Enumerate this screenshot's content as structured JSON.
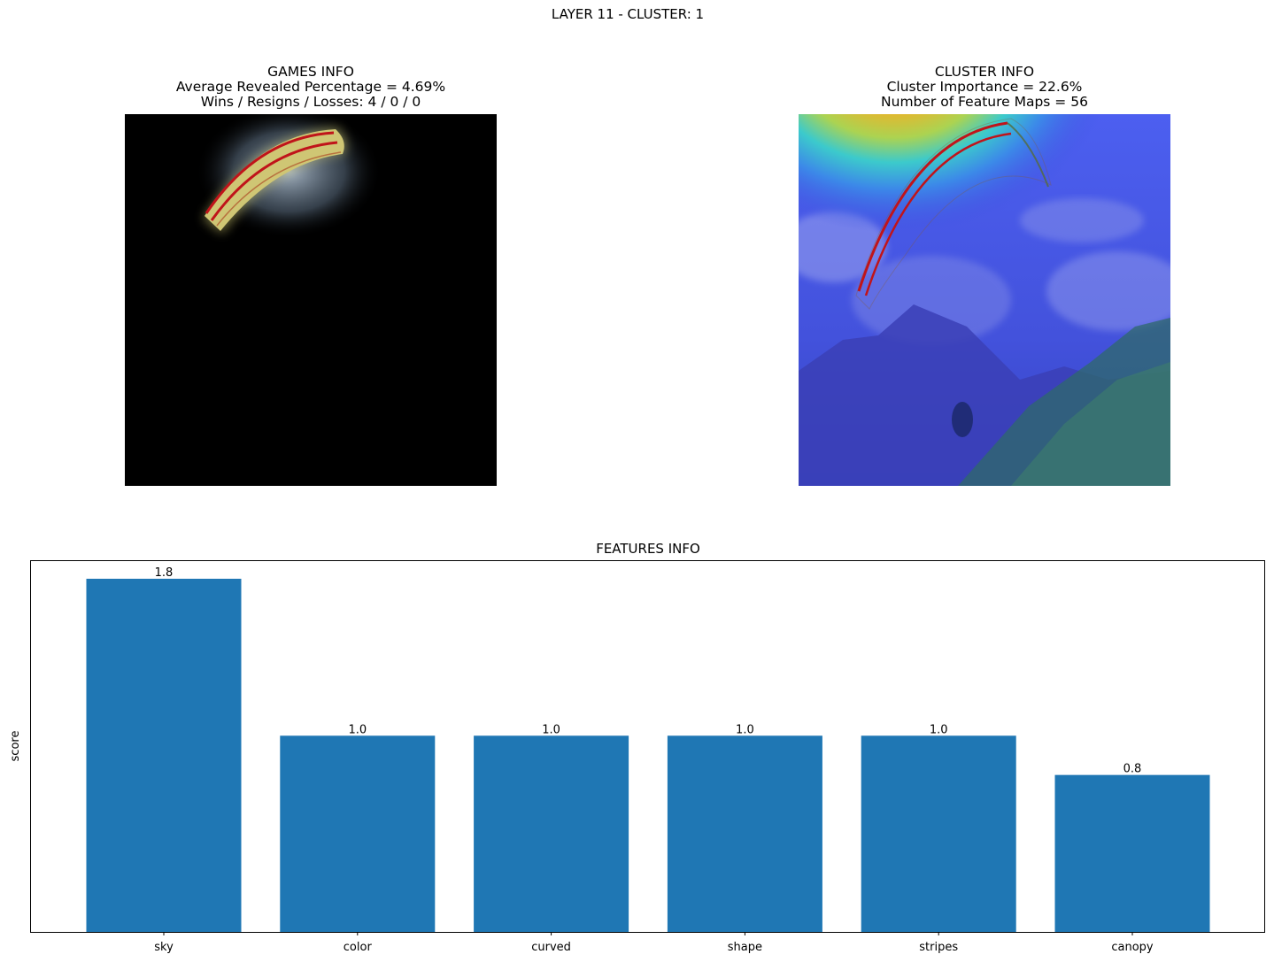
{
  "figure": {
    "title": "LAYER 11 - CLUSTER: 1"
  },
  "games_info": {
    "title": "GAMES INFO",
    "line1": "Average Revealed Percentage = 4.69%",
    "line2": "Wins / Resigns / Losses: 4 / 0 / 0",
    "image": "masked-paraglider-image"
  },
  "cluster_info": {
    "title": "CLUSTER INFO",
    "line1": "Cluster Importance = 22.6%",
    "line2": "Number of Feature Maps = 56",
    "image": "paraglider-heatmap-overlay"
  },
  "features_info": {
    "title": "FEATURES INFO"
  },
  "colors": {
    "bar": "#1f77b4",
    "masked_background": "#000000",
    "canopy_yellow": "#c9c26a",
    "canopy_red": "#c0141a"
  },
  "chart_data": {
    "type": "bar",
    "title": "FEATURES INFO",
    "xlabel": "",
    "ylabel": "score",
    "categories": [
      "sky",
      "color",
      "curved",
      "shape",
      "stripes",
      "canopy"
    ],
    "values": [
      1.8,
      1.0,
      1.0,
      1.0,
      1.0,
      0.8
    ],
    "data_labels": [
      "1.8",
      "1.0",
      "1.0",
      "1.0",
      "1.0",
      "0.8"
    ],
    "ylim": [
      0,
      1.89
    ],
    "y_ticks_shown": false,
    "grid": false
  }
}
